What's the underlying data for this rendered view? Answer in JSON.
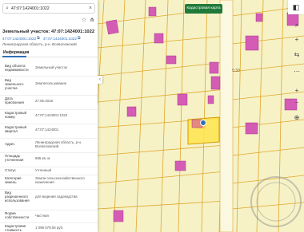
{
  "search": {
    "value": "47:07:1424001:1022",
    "placeholder": ""
  },
  "object": {
    "title": "Земельный участок: 47:07:1424001:1022",
    "cadastral_link": "47:07:1424001:1022",
    "quarter_link": "47:07:1424001:1022",
    "subtitle": "Ленинградская область, р-н. Всеволожский"
  },
  "tabs": [
    {
      "label": "Информация"
    }
  ],
  "info": [
    {
      "k": "Вид объекта недвижимости",
      "v": "Земельный участок"
    },
    {
      "k": "Вид земельного участка",
      "v": "Землепользование"
    },
    {
      "k": "Дата присвоения",
      "v": "27.06.2018"
    },
    {
      "k": "Кадастровый номер",
      "v": "47:07:1424001:1022"
    },
    {
      "k": "Кадастровый квартал",
      "v": "47:07:1424001"
    },
    {
      "k": "Адрес",
      "v": "Ленинградская область, р-н. Всеволожский"
    },
    {
      "k": "Площадь уточненная",
      "v": "965 кв. м"
    },
    {
      "k": "Статус",
      "v": "Учтенный"
    },
    {
      "k": "Категория земель",
      "v": "Земли сельскохозяйственного назначения"
    },
    {
      "k": "Вид разрешенного использования",
      "v": "для ведения садоводства"
    },
    {
      "k": "Форма собственности",
      "v": "Частная"
    },
    {
      "k": "Кадастровая стоимость",
      "v": "1 098 579,06 руб."
    }
  ],
  "map": {
    "top_button": "Кадастровая карта",
    "label": "5:30"
  },
  "colors": {
    "accent": "#2f6fb7",
    "building": "#d45cb5",
    "selected_parcel": "#ffe54d",
    "green_button": "#1f7a3a"
  }
}
